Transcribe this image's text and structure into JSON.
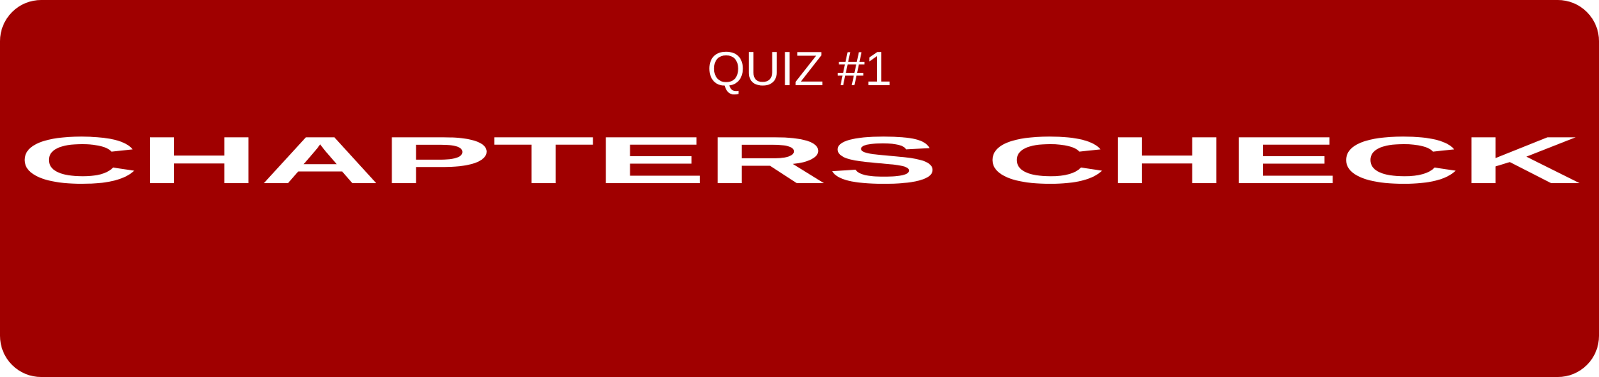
{
  "banner": {
    "subtitle": "QUIZ #1",
    "title": "CHAPTERS CHECK",
    "background_color": "#a00000",
    "text_color": "#ffffff"
  }
}
